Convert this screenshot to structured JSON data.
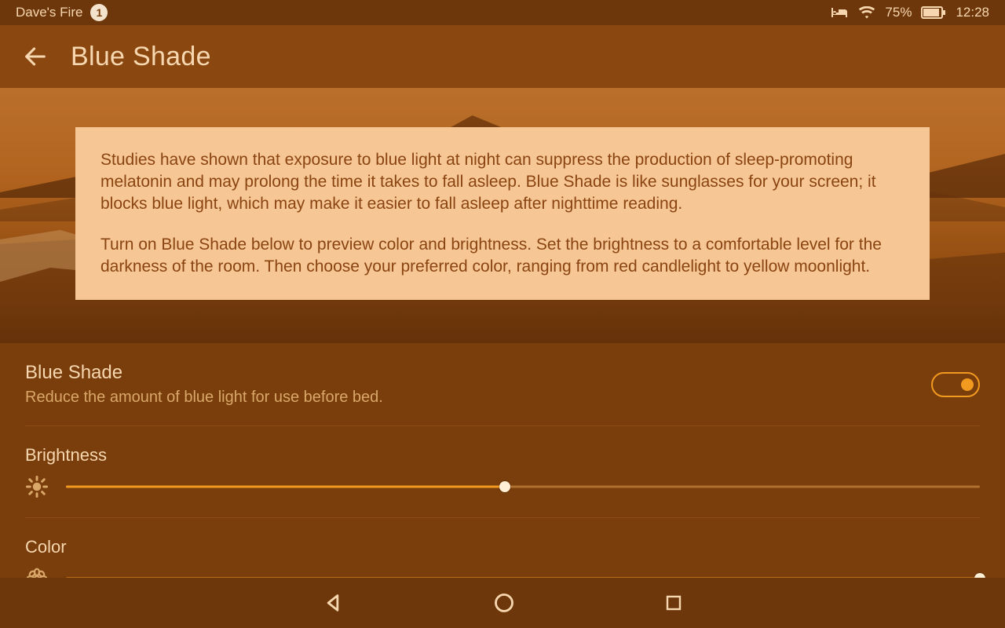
{
  "status": {
    "device_name": "Dave's Fire",
    "badge": "1",
    "battery_pct": "75%",
    "clock": "12:28"
  },
  "header": {
    "title": "Blue Shade"
  },
  "card": {
    "p1": "Studies have shown that exposure to blue light at night can suppress the production of sleep-promoting melatonin and may prolong the time it takes to fall asleep. Blue Shade is like sunglasses for your screen; it blocks blue light, which may make it easier to fall asleep after nighttime reading.",
    "p2": "Turn on Blue Shade below to preview color and brightness. Set the brightness to a comfortable level for the darkness of the room. Then choose your preferred color, ranging from red candlelight to yellow moonlight."
  },
  "toggle": {
    "title": "Blue Shade",
    "subtitle": "Reduce the amount of blue light for use before bed.",
    "on": true
  },
  "sliders": {
    "brightness": {
      "label": "Brightness",
      "value_pct": 48
    },
    "color": {
      "label": "Color",
      "value_pct": 100
    }
  }
}
